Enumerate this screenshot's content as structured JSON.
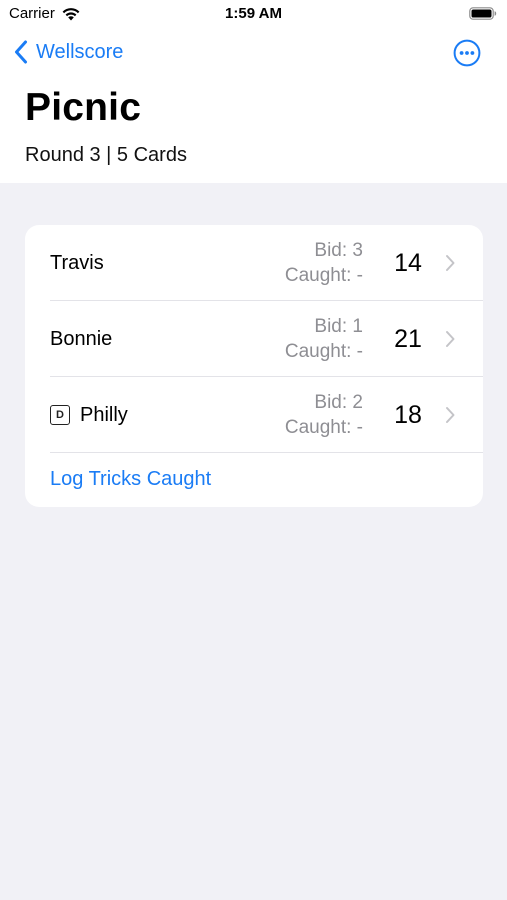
{
  "status_bar": {
    "carrier": "Carrier",
    "time": "1:59 AM"
  },
  "nav": {
    "back_label": "Wellscore"
  },
  "header": {
    "title": "Picnic",
    "subtitle": "Round 3  |  5 Cards"
  },
  "players": [
    {
      "name": "Travis",
      "bid": "Bid:  3",
      "caught": "Caught: -",
      "score": "14",
      "dealer": false
    },
    {
      "name": "Bonnie",
      "bid": "Bid:  1",
      "caught": "Caught: -",
      "score": "21",
      "dealer": false
    },
    {
      "name": "Philly",
      "bid": "Bid:  2",
      "caught": "Caught: -",
      "score": "18",
      "dealer": true,
      "dealer_badge": "D"
    }
  ],
  "actions": {
    "log_tricks": "Log Tricks Caught"
  },
  "colors": {
    "accent": "#1a7cf5",
    "background": "#f1f1f6",
    "secondary_text": "#8e8e93"
  }
}
